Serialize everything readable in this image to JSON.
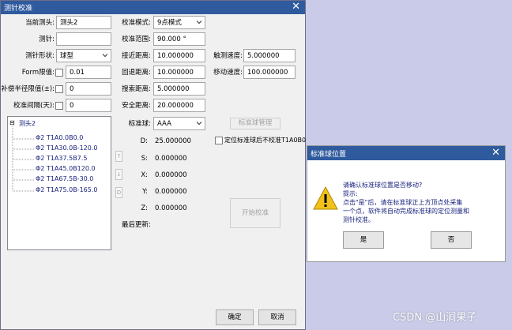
{
  "main": {
    "title": "测针校准",
    "close": "✕",
    "left_fields": [
      {
        "label": "当前测头:",
        "value": "测头2"
      },
      {
        "label": "测针:",
        "value": ""
      },
      {
        "label": "测针形状:",
        "value": "球型"
      },
      {
        "label": "Form限值:",
        "value": "0.01"
      },
      {
        "label": "补偿半径限值(±):",
        "value": "0"
      },
      {
        "label": "校准间隔(天):",
        "value": "0"
      }
    ],
    "mid_fields": [
      {
        "label": "校准模式:",
        "value": "9点模式"
      },
      {
        "label": "校准范围:",
        "value": "90.000 °"
      },
      {
        "label": "接近距离:",
        "value": "10.000000"
      },
      {
        "label": "回退距离:",
        "value": "10.000000"
      },
      {
        "label": "搜索距离:",
        "value": "5.000000"
      },
      {
        "label": "安全距离:",
        "value": "20.000000"
      }
    ],
    "right_fields": [
      {
        "label": "触测速度:",
        "value": "5.000000"
      },
      {
        "label": "移动速度:",
        "value": "100.000000"
      }
    ],
    "ball": {
      "label": "标准球:",
      "value": "AAA",
      "manage_button": "标准球管理"
    },
    "reposition_check": "定位标准球后不校准T1A0B0",
    "coords": [
      {
        "label": "D:",
        "value": "25.000000"
      },
      {
        "label": "S:",
        "value": "0.000000"
      },
      {
        "label": "X:",
        "value": "0.000000"
      },
      {
        "label": "Y:",
        "value": "0.000000"
      },
      {
        "label": "Z:",
        "value": "0.000000"
      }
    ],
    "last_update_label": "最后更新:",
    "start_button": "开始校准",
    "side_buttons": [
      "↑",
      "↓",
      "D"
    ],
    "tree": {
      "root": "测头2",
      "expander": "⊟",
      "children": [
        "Φ2 T1A0.0B0.0",
        "Φ2 T1A30.0B-120.0",
        "Φ2 T1A37.5B7.5",
        "Φ2 T1A45.0B120.0",
        "Φ2 T1A67.5B-30.0",
        "Φ2 T1A75.0B-165.0"
      ]
    },
    "ok_button": "确定",
    "cancel_button": "取消"
  },
  "dialog": {
    "title": "标准球位置",
    "close": "✕",
    "lines": [
      "请确认标准球位置是否移动?",
      "提示:",
      "点击\"是\"后，请在标准球正上方顶点处采集",
      "一个点，软件将自动完成标准球的定位测量和",
      "测针校准。"
    ],
    "yes_button": "是",
    "no_button": "否"
  },
  "watermark": "CSDN @山涧果子",
  "colors": {
    "titlebar": "#2f5b9e",
    "tree_text": "#1a237e",
    "background": "#c9cbe8"
  }
}
